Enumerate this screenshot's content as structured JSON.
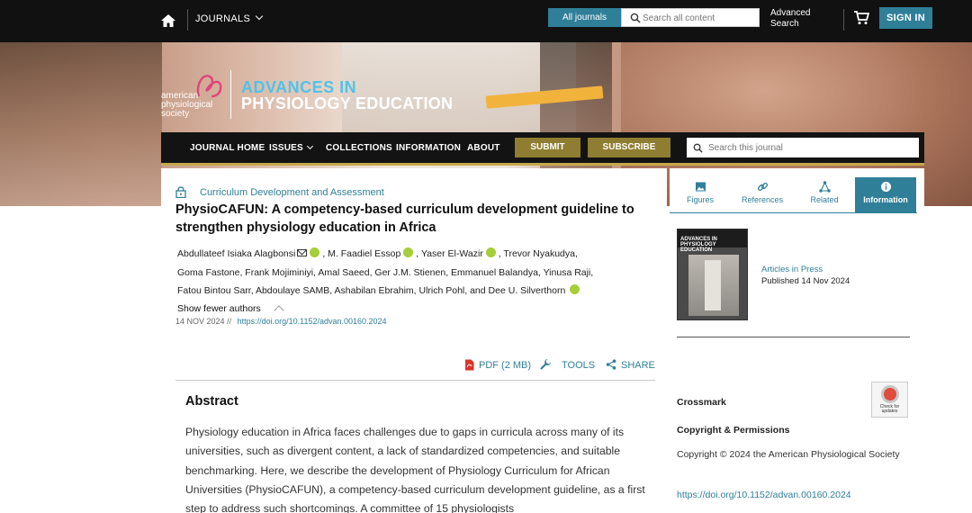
{
  "topbar": {
    "journals_label": "JOURNALS",
    "all_journals_label": "All journals",
    "search_placeholder": "Search all content",
    "advanced_search_line1": "Advanced",
    "advanced_search_line2": "Search",
    "sign_in_label": "SIGN IN"
  },
  "banner": {
    "society_line1": "american",
    "society_line2": "physiological",
    "society_line3": "society",
    "journal_line1": "ADVANCES IN",
    "journal_line2": "PHYSIOLOGY EDUCATION"
  },
  "journal_nav": {
    "home": "JOURNAL HOME",
    "issues": "ISSUES",
    "collections": "COLLECTIONS",
    "information": "INFORMATION",
    "about": "ABOUT",
    "submit": "SUBMIT",
    "subscribe": "SUBSCRIBE",
    "search_placeholder": "Search this journal"
  },
  "article": {
    "category": "Curriculum Development and Assessment",
    "title": "PhysioCAFUN: A competency-based curriculum development guideline to strengthen physiology education in Africa",
    "authors": {
      "a1": "Abdullateef Isiaka Alagbonsi",
      "a2": ", M. Faadiel Essop",
      "a3": ", Yaser El-Wazir",
      "a4": ", Trevor Nyakudya,",
      "line2": "Goma Fastone, Frank Mojiminiyi, Amal Saeed, Ger J.M. Stienen, Emmanuel Balandya, Yinusa Raji,",
      "line3": "Fatou Bintou Sarr, Abdoulaye SAMB, Ashabilan Ebrahim, Ulrich Pohl, and Dee U. Silverthorn"
    },
    "show_fewer": "Show fewer authors",
    "date": "14 NOV 2024",
    "date_sep": "//",
    "doi": "https://doi.org/10.1152/advan.00160.2024",
    "actions": {
      "pdf": "PDF (2 MB)",
      "tools": "TOOLS",
      "share": "SHARE"
    },
    "abstract_heading": "Abstract",
    "abstract_text": "Physiology education in Africa faces challenges due to gaps in curricula across many of its universities, such as divergent content, a lack of standardized competencies, and suitable benchmarking. Here, we describe the development of Physiology Curriculum for African Universities (PhysioCAFUN), a competency-based curriculum development guideline, as a first step to address such shortcomings. A committee of 15 physiologists"
  },
  "side_panel": {
    "tabs": {
      "figures": "Figures",
      "references": "References",
      "related": "Related",
      "information": "Information"
    },
    "cover_title_line1": "ADVANCES IN",
    "cover_title_line2": "PHYSIOLOGY",
    "cover_title_line3": "EDUCATION",
    "articles_in_press": "Articles in Press",
    "published": "Published 14 Nov 2024",
    "crossmark": "Crossmark",
    "crossmark_badge_line1": "Check for",
    "crossmark_badge_line2": "updates",
    "copyright_heading": "Copyright & Permissions",
    "copyright_text": "Copyright © 2024 the American Physiological Society",
    "doi": "https://doi.org/10.1152/advan.00160.2024"
  },
  "colors": {
    "accent": "#2f7f99",
    "nav_button": "#8f7d31",
    "brand_cyan": "#4ec3ea",
    "orcid": "#a6ce39"
  }
}
